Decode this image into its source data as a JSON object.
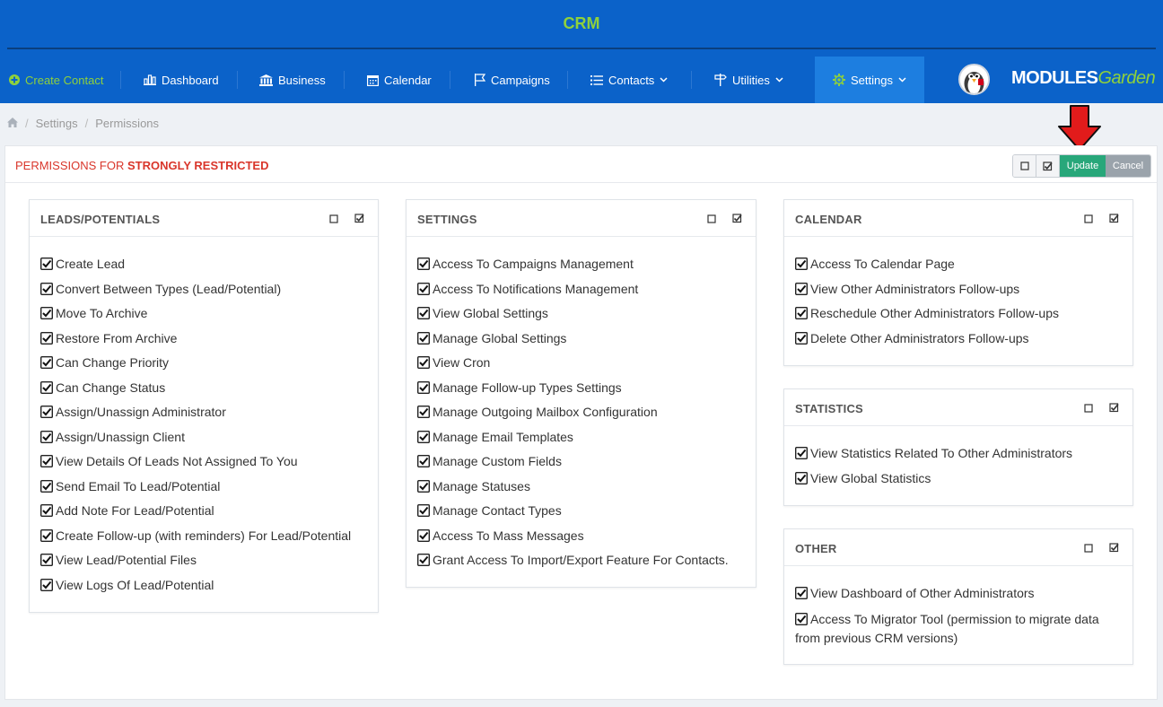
{
  "header": {
    "brand": "CRM",
    "nav": [
      {
        "label": "Create Contact",
        "icon": "plus-circle-icon"
      },
      {
        "label": "Dashboard",
        "icon": "bar-chart-icon"
      },
      {
        "label": "Business",
        "icon": "bank-icon"
      },
      {
        "label": "Calendar",
        "icon": "calendar-icon"
      },
      {
        "label": "Campaigns",
        "icon": "flag-icon"
      },
      {
        "label": "Contacts",
        "icon": "list-icon"
      },
      {
        "label": "Utilities",
        "icon": "signpost-icon"
      },
      {
        "label": "Settings",
        "icon": "gear-icon"
      }
    ],
    "logo_main": "MODULES",
    "logo_accent": "Garden"
  },
  "breadcrumb": {
    "items": [
      "Settings",
      "Permissions"
    ],
    "home_icon": "home-icon"
  },
  "panel": {
    "title_prefix": "PERMISSIONS FOR",
    "title_role": "STRONGLY RESTRICTED",
    "update_label": "Update",
    "cancel_label": "Cancel"
  },
  "colors": {
    "header_bg": "#0b62c9",
    "brand": "#8fd13b",
    "active_nav": "#1d7ee0",
    "title_red": "#d9362b",
    "update": "#28a77a",
    "cancel": "#9aa3ab"
  },
  "cards": {
    "leads": {
      "title": "LEADS/POTENTIALS",
      "items": [
        "Create Lead",
        "Convert Between Types (Lead/Potential)",
        "Move To Archive",
        "Restore From Archive",
        "Can Change Priority",
        "Can Change Status",
        "Assign/Unassign Administrator",
        "Assign/Unassign Client",
        "View Details Of Leads Not Assigned To You",
        "Send Email To Lead/Potential",
        "Add Note For Lead/Potential",
        "Create Follow-up (with reminders) For Lead/Potential",
        "View Lead/Potential Files",
        "View Logs Of Lead/Potential"
      ]
    },
    "settings": {
      "title": "SETTINGS",
      "items": [
        "Access To Campaigns Management",
        "Access To Notifications Management",
        "View Global Settings",
        "Manage Global Settings",
        "View Cron",
        "Manage Follow-up Types Settings",
        "Manage Outgoing Mailbox Configuration",
        "Manage Email Templates",
        "Manage Custom Fields",
        "Manage Statuses",
        "Manage Contact Types",
        "Access To Mass Messages",
        "Grant Access To Import/Export Feature For Contacts."
      ]
    },
    "calendar": {
      "title": "CALENDAR",
      "items": [
        "Access To Calendar Page",
        "View Other Administrators Follow-ups",
        "Reschedule Other Administrators Follow-ups",
        "Delete Other Administrators Follow-ups"
      ]
    },
    "statistics": {
      "title": "STATISTICS",
      "items": [
        "View Statistics Related To Other Administrators",
        "View Global Statistics"
      ]
    },
    "other": {
      "title": "OTHER",
      "items": [
        "View Dashboard of Other Administrators",
        "Access To Migrator Tool (permission to migrate data from previous CRM versions)"
      ]
    }
  }
}
